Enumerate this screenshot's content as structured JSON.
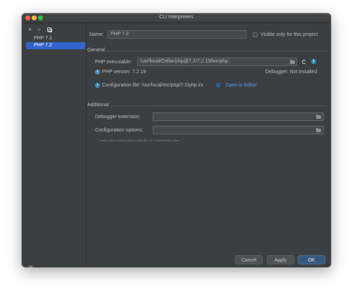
{
  "window": {
    "title": "CLI Interpreters"
  },
  "sidebar": {
    "toolbar": {
      "add": "+",
      "remove": "−"
    },
    "items": [
      {
        "label": "PHP 7.1",
        "selected": false
      },
      {
        "label": "PHP 7.2",
        "selected": true
      }
    ]
  },
  "form": {
    "name_label": "Name:",
    "name_value": "PHP 7.2",
    "visible_only_label": "Visible only for this project",
    "general_title": "General",
    "php_executable_label": "PHP executable:",
    "php_executable_value": "/usr/local/Cellar/php@7.2/7.2.19/bin/php",
    "php_version_text": "PHP version: 7.2.19",
    "debugger_text": "Debugger: Not installed",
    "config_file_text": "Configuration file: /usr/local/etc/php/7.2/php.ini",
    "open_in_editor": "Open in Editor",
    "additional_title": "Additional",
    "debugger_extension_label": "Debugger extension:",
    "debugger_extension_value": "",
    "config_options_label": "Configuration options:",
    "config_options_value": "",
    "config_options_hint": "These options will be passed using the \"-d\" command line option"
  },
  "footer": {
    "help": "?",
    "cancel": "Cancel",
    "apply": "Apply",
    "ok": "OK"
  },
  "colors": {
    "background": "#3c3f41",
    "selection": "#2f65ca",
    "link": "#589df6",
    "primary_button": "#365880"
  }
}
